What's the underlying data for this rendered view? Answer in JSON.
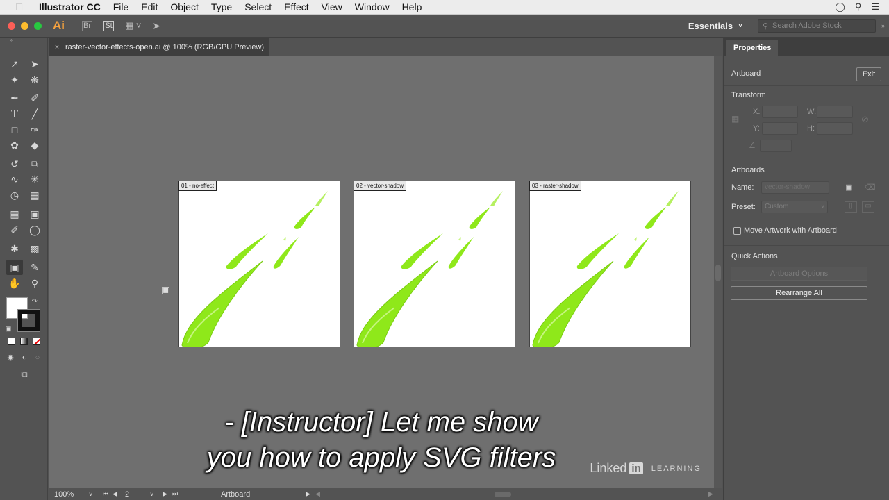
{
  "menubar": {
    "app_name": "Illustrator CC",
    "items": [
      "File",
      "Edit",
      "Object",
      "Type",
      "Select",
      "Effect",
      "View",
      "Window",
      "Help"
    ]
  },
  "appbar": {
    "logo": "Ai",
    "bridge": "Br",
    "stock": "St",
    "workspace": "Essentials",
    "search_placeholder": "Search Adobe Stock"
  },
  "document": {
    "tab_title": "raster-vector-effects-open.ai @ 100% (RGB/GPU Preview)"
  },
  "artboards": [
    {
      "label": "01 - no-effect"
    },
    {
      "label": "02 - vector-shadow"
    },
    {
      "label": "03 - raster-shadow"
    }
  ],
  "subtitle": {
    "line1": "- [Instructor] Let me show",
    "line2": "you how to apply SVG filters"
  },
  "statusbar": {
    "zoom": "100%",
    "artboard_number": "2",
    "tool_name": "Artboard"
  },
  "panel": {
    "tab": "Properties",
    "artboard_label": "Artboard",
    "exit_label": "Exit",
    "transform_title": "Transform",
    "x_label": "X:",
    "y_label": "Y:",
    "w_label": "W:",
    "h_label": "H:",
    "artboards_title": "Artboards",
    "name_label": "Name:",
    "name_value": "vector-shadow",
    "preset_label": "Preset:",
    "preset_value": "Custom",
    "move_artwork_label": "Move Artwork with Artboard",
    "quick_actions_title": "Quick Actions",
    "artboard_options_label": "Artboard Options",
    "rearrange_label": "Rearrange All"
  },
  "watermark": {
    "brand": "Linked",
    "in": "in",
    "learning": "LEARNING"
  },
  "colors": {
    "accent_green": "#8fe81a",
    "canvas_bg": "#6f6f6f",
    "ui_bg": "#535353"
  }
}
